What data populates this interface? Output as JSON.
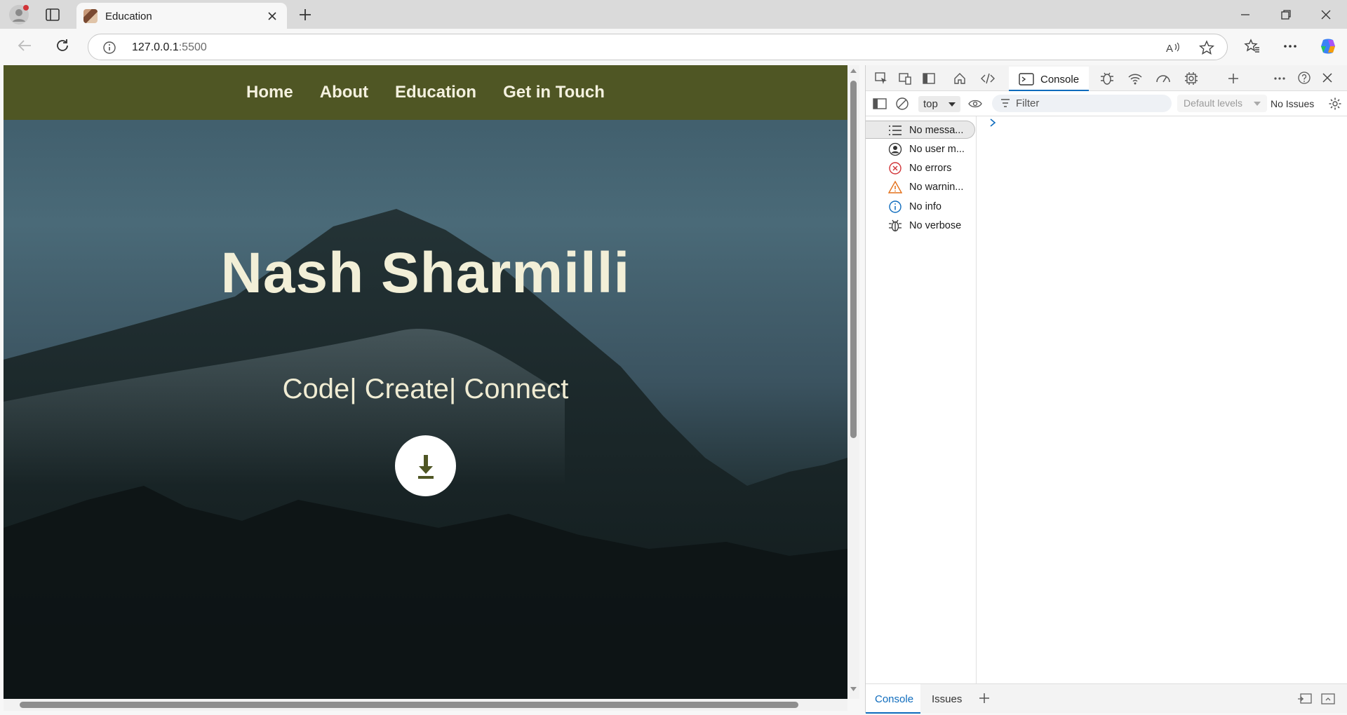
{
  "browser": {
    "tab_title": "Education",
    "url_host": "127.0.0.1",
    "url_port": ":5500"
  },
  "site": {
    "nav": [
      "Home",
      "About",
      "Education",
      "Get in Touch"
    ],
    "hero_name": "Nash Sharmilli",
    "hero_tagline": "Code| Create| Connect",
    "colors": {
      "navbar": "#4f5624",
      "hero_text": "#f2efd7",
      "download_icon": "#4f5624"
    }
  },
  "devtools": {
    "console_tab": "Console",
    "context": "top",
    "filter_placeholder": "Filter",
    "levels": "Default levels",
    "issues": "No Issues",
    "sidebar": [
      {
        "label": "No messa...",
        "icon": "list-icon"
      },
      {
        "label": "No user m...",
        "icon": "user-icon"
      },
      {
        "label": "No errors",
        "icon": "error-icon"
      },
      {
        "label": "No warnin...",
        "icon": "warning-icon"
      },
      {
        "label": "No info",
        "icon": "info-icon"
      },
      {
        "label": "No verbose",
        "icon": "bug-icon"
      }
    ],
    "drawer_tabs": [
      "Console",
      "Issues"
    ]
  }
}
